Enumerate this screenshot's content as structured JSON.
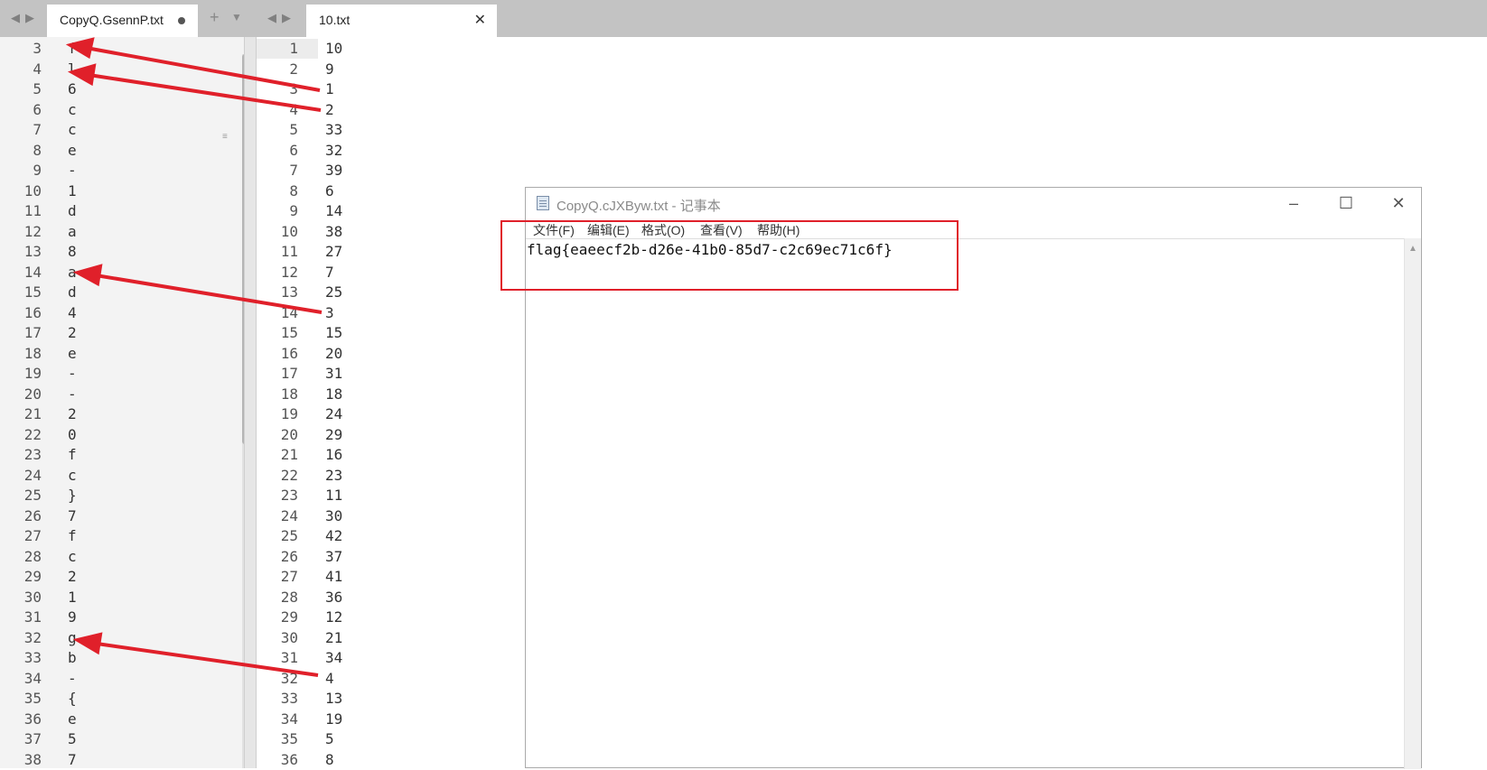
{
  "tabs": [
    {
      "label": "CopyQ.GsennP.txt",
      "modified": true
    },
    {
      "label": "10.txt",
      "modified": false
    }
  ],
  "left_lines": [
    {
      "n": "3",
      "t": "f"
    },
    {
      "n": "4",
      "t": "l"
    },
    {
      "n": "5",
      "t": "6"
    },
    {
      "n": "6",
      "t": "c"
    },
    {
      "n": "7",
      "t": "c"
    },
    {
      "n": "8",
      "t": "e"
    },
    {
      "n": "9",
      "t": "-"
    },
    {
      "n": "10",
      "t": "1"
    },
    {
      "n": "11",
      "t": "d"
    },
    {
      "n": "12",
      "t": "a"
    },
    {
      "n": "13",
      "t": "8"
    },
    {
      "n": "14",
      "t": "a"
    },
    {
      "n": "15",
      "t": "d"
    },
    {
      "n": "16",
      "t": "4"
    },
    {
      "n": "17",
      "t": "2"
    },
    {
      "n": "18",
      "t": "e"
    },
    {
      "n": "19",
      "t": "-"
    },
    {
      "n": "20",
      "t": "-"
    },
    {
      "n": "21",
      "t": "2"
    },
    {
      "n": "22",
      "t": "0"
    },
    {
      "n": "23",
      "t": "f"
    },
    {
      "n": "24",
      "t": "c"
    },
    {
      "n": "25",
      "t": "}"
    },
    {
      "n": "26",
      "t": "7"
    },
    {
      "n": "27",
      "t": "f"
    },
    {
      "n": "28",
      "t": "c"
    },
    {
      "n": "29",
      "t": "2"
    },
    {
      "n": "30",
      "t": "1"
    },
    {
      "n": "31",
      "t": "9"
    },
    {
      "n": "32",
      "t": "g"
    },
    {
      "n": "33",
      "t": "b"
    },
    {
      "n": "34",
      "t": "-"
    },
    {
      "n": "35",
      "t": "{"
    },
    {
      "n": "36",
      "t": "e"
    },
    {
      "n": "37",
      "t": "5"
    },
    {
      "n": "38",
      "t": "7"
    }
  ],
  "right_lines": [
    {
      "n": "1",
      "t": "10"
    },
    {
      "n": "2",
      "t": "9"
    },
    {
      "n": "3",
      "t": "1"
    },
    {
      "n": "4",
      "t": "2"
    },
    {
      "n": "5",
      "t": "33"
    },
    {
      "n": "6",
      "t": "32"
    },
    {
      "n": "7",
      "t": "39"
    },
    {
      "n": "8",
      "t": "6"
    },
    {
      "n": "9",
      "t": "14"
    },
    {
      "n": "10",
      "t": "38"
    },
    {
      "n": "11",
      "t": "27"
    },
    {
      "n": "12",
      "t": "7"
    },
    {
      "n": "13",
      "t": "25"
    },
    {
      "n": "14",
      "t": "3"
    },
    {
      "n": "15",
      "t": "15"
    },
    {
      "n": "16",
      "t": "20"
    },
    {
      "n": "17",
      "t": "31"
    },
    {
      "n": "18",
      "t": "18"
    },
    {
      "n": "19",
      "t": "24"
    },
    {
      "n": "20",
      "t": "29"
    },
    {
      "n": "21",
      "t": "16"
    },
    {
      "n": "22",
      "t": "23"
    },
    {
      "n": "23",
      "t": "11"
    },
    {
      "n": "24",
      "t": "30"
    },
    {
      "n": "25",
      "t": "42"
    },
    {
      "n": "26",
      "t": "37"
    },
    {
      "n": "27",
      "t": "41"
    },
    {
      "n": "28",
      "t": "36"
    },
    {
      "n": "29",
      "t": "12"
    },
    {
      "n": "30",
      "t": "21"
    },
    {
      "n": "31",
      "t": "34"
    },
    {
      "n": "32",
      "t": "4"
    },
    {
      "n": "33",
      "t": "13"
    },
    {
      "n": "34",
      "t": "19"
    },
    {
      "n": "35",
      "t": "5"
    },
    {
      "n": "36",
      "t": "8"
    }
  ],
  "notepad": {
    "title": "CopyQ.cJXByw.txt - 记事本",
    "menu": [
      "文件(F)",
      "编辑(E)",
      "格式(O)",
      "查看(V)",
      "帮助(H)"
    ],
    "content": "flag{eaeecf2b-d26e-41b0-85d7-c2c69ec71c6f}"
  },
  "annotation_color": "#e0202a",
  "icons": [
    "nav-left-icon",
    "nav-right-icon",
    "add-tab-icon",
    "tab-dropdown-icon",
    "notepad-icon",
    "minimize-icon",
    "maximize-icon",
    "close-icon"
  ]
}
